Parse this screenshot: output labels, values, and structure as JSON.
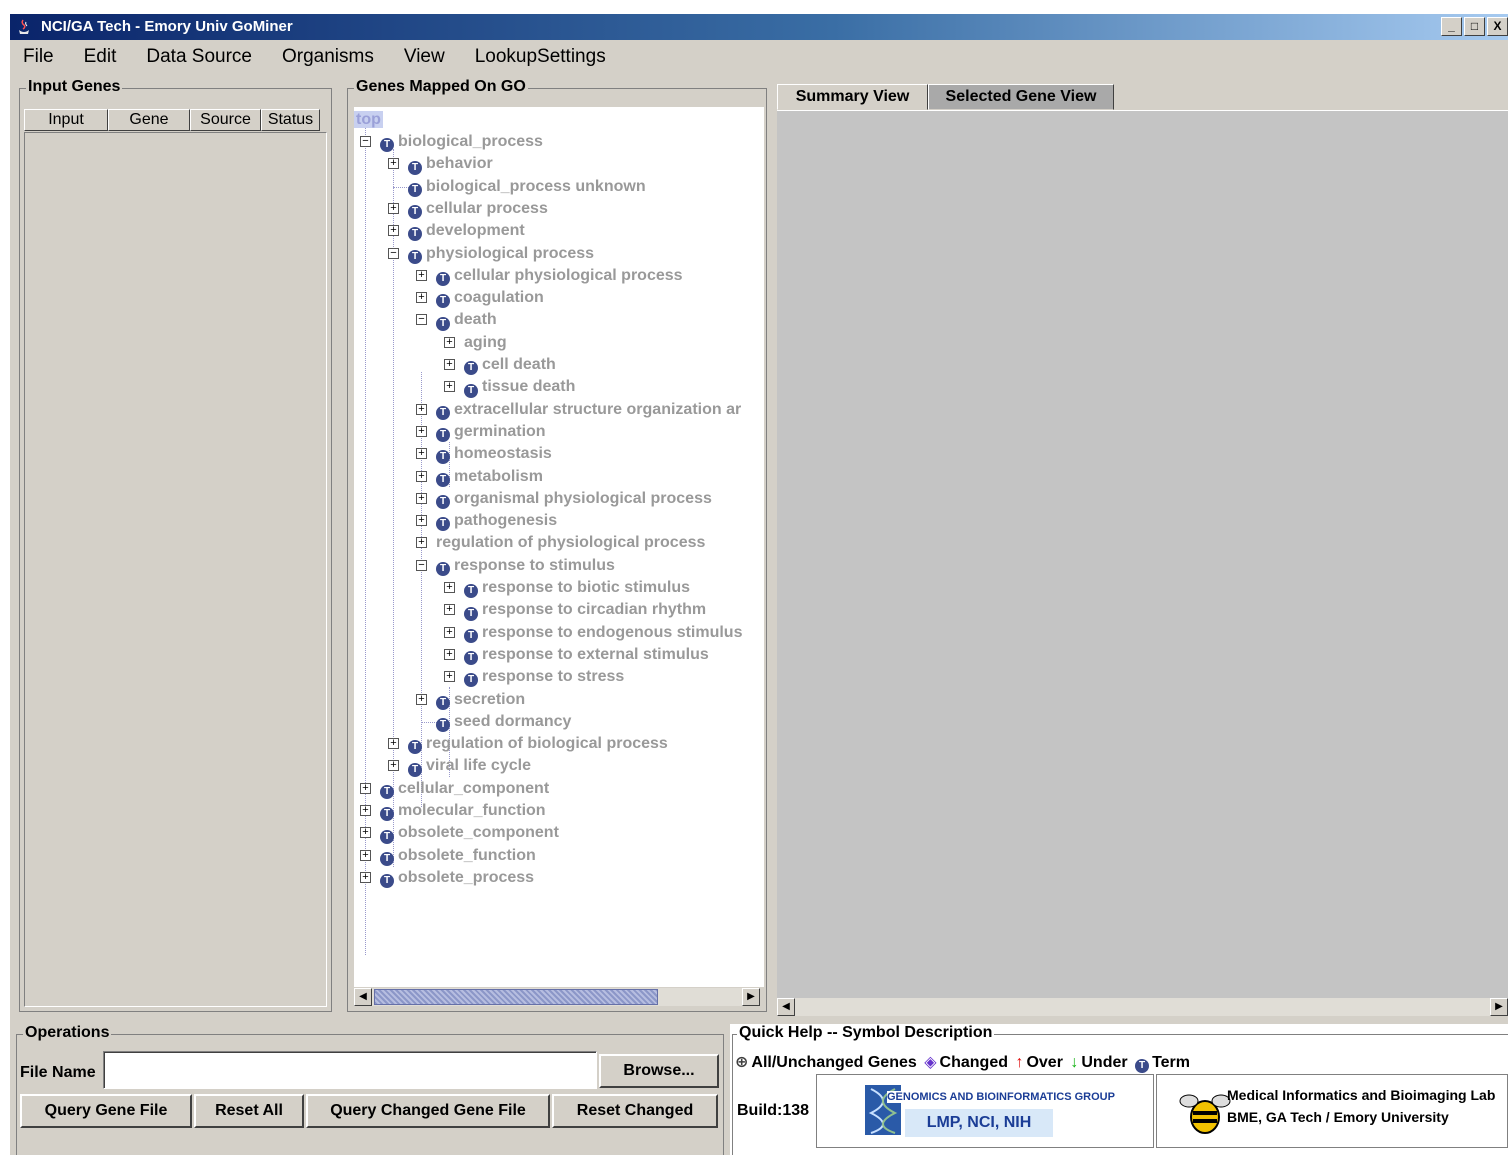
{
  "window": {
    "title": "NCI/GA Tech - Emory Univ GoMiner",
    "controls": [
      "_",
      "□",
      "X"
    ]
  },
  "menu": [
    "File",
    "Edit",
    "Data Source",
    "Organisms",
    "View",
    "LookupSettings"
  ],
  "input_genes": {
    "legend": "Input Genes",
    "columns": [
      "Input",
      "Gene",
      "Source",
      "Status"
    ]
  },
  "go_tree": {
    "legend": "Genes Mapped On GO",
    "root_label": "top",
    "nodes": [
      {
        "label": "biological_process",
        "expander": "⊟"
      },
      {
        "label": "behavior",
        "expander": "⊞"
      },
      {
        "label": "biological_process unknown",
        "expander": ""
      },
      {
        "label": "cellular process",
        "expander": "⊞"
      },
      {
        "label": "development",
        "expander": "⊞"
      },
      {
        "label": "physiological process",
        "expander": "⊟"
      },
      {
        "label": "cellular physiological process",
        "expander": "⊞"
      },
      {
        "label": "coagulation",
        "expander": "⊞"
      },
      {
        "label": "death",
        "expander": "⊟"
      },
      {
        "label": "aging",
        "expander": "⊞"
      },
      {
        "label": "cell death",
        "expander": "⊞"
      },
      {
        "label": "tissue death",
        "expander": "⊞"
      },
      {
        "label": "extracellular structure organization ar",
        "expander": "⊞"
      },
      {
        "label": "germination",
        "expander": "⊞"
      },
      {
        "label": "homeostasis",
        "expander": "⊞"
      },
      {
        "label": "metabolism",
        "expander": "⊞"
      },
      {
        "label": "organismal physiological process",
        "expander": "⊞"
      },
      {
        "label": "pathogenesis",
        "expander": "⊞"
      },
      {
        "label": "regulation of physiological process",
        "expander": "⊞"
      },
      {
        "label": "response to stimulus",
        "expander": "⊟"
      },
      {
        "label": "response to biotic stimulus",
        "expander": "⊞"
      },
      {
        "label": "response to circadian rhythm",
        "expander": "⊞"
      },
      {
        "label": "response to endogenous stimulus",
        "expander": "⊞"
      },
      {
        "label": "response to external stimulus",
        "expander": "⊞"
      },
      {
        "label": "response to stress",
        "expander": "⊞"
      },
      {
        "label": "secretion",
        "expander": "⊞"
      },
      {
        "label": "seed dormancy",
        "expander": ""
      },
      {
        "label": "regulation of biological process",
        "expander": "⊞"
      },
      {
        "label": "viral life cycle",
        "expander": "⊞"
      },
      {
        "label": "cellular_component",
        "expander": "⊞"
      },
      {
        "label": "molecular_function",
        "expander": "⊞"
      },
      {
        "label": "obsolete_component",
        "expander": "⊞"
      },
      {
        "label": "obsolete_function",
        "expander": "⊞"
      },
      {
        "label": "obsolete_process",
        "expander": "⊞"
      }
    ]
  },
  "tabs": [
    {
      "label": "Summary View",
      "active": true
    },
    {
      "label": "Selected Gene View",
      "active": false
    }
  ],
  "operations": {
    "legend": "Operations",
    "file_name_label": "File Name",
    "file_name_value": "",
    "browse_label": "Browse...",
    "buttons": [
      "Query Gene File",
      "Reset All",
      "Query Changed Gene File",
      "Reset Changed"
    ]
  },
  "quick_help": {
    "legend": "Quick Help -- Symbol Description",
    "symbols": [
      {
        "icon": "⊕",
        "label": "All/Unchanged Genes",
        "color": "#404040"
      },
      {
        "icon": "◈",
        "label": "Changed",
        "color": "#6633cc"
      },
      {
        "icon": "↑",
        "label": "Over",
        "color": "#e01010"
      },
      {
        "icon": "↓",
        "label": "Under",
        "color": "#10b010"
      },
      {
        "icon": "T",
        "label": "Term",
        "color": "#3b4b8a"
      }
    ],
    "build_label": "Build:138"
  },
  "logos": {
    "gbg_line1": "GENOMICS AND BIOINFORMATICS GROUP",
    "gbg_line2": "LMP, NCI, NIH",
    "mibl_line1": "Medical Informatics and Bioimaging Lab",
    "mibl_line2": "BME, GA Tech / Emory University"
  },
  "colors": {
    "titlebar_start": "#0a246a",
    "panel_bg": "#d4d0c8",
    "tree_text": "#999999",
    "term_icon": "#3b4b8a",
    "inactive_tab": "#a9a9a9"
  }
}
